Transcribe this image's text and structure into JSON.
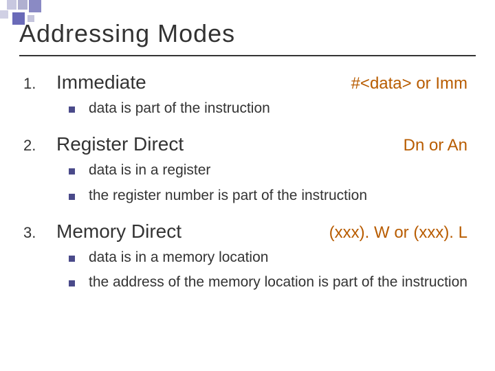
{
  "title": "Addressing Modes",
  "items": [
    {
      "num": "1.",
      "heading": "Immediate",
      "syntax": "#<data> or Imm",
      "subs": [
        "data is part of the instruction"
      ]
    },
    {
      "num": "2.",
      "heading": "Register Direct",
      "syntax": "Dn or An",
      "subs": [
        "data is in a register",
        "the register number is part of the instruction"
      ]
    },
    {
      "num": "3.",
      "heading": "Memory Direct",
      "syntax": "(xxx). W or (xxx). L",
      "subs": [
        "data is in a memory location",
        "the address of the memory location is part of the instruction"
      ]
    }
  ]
}
